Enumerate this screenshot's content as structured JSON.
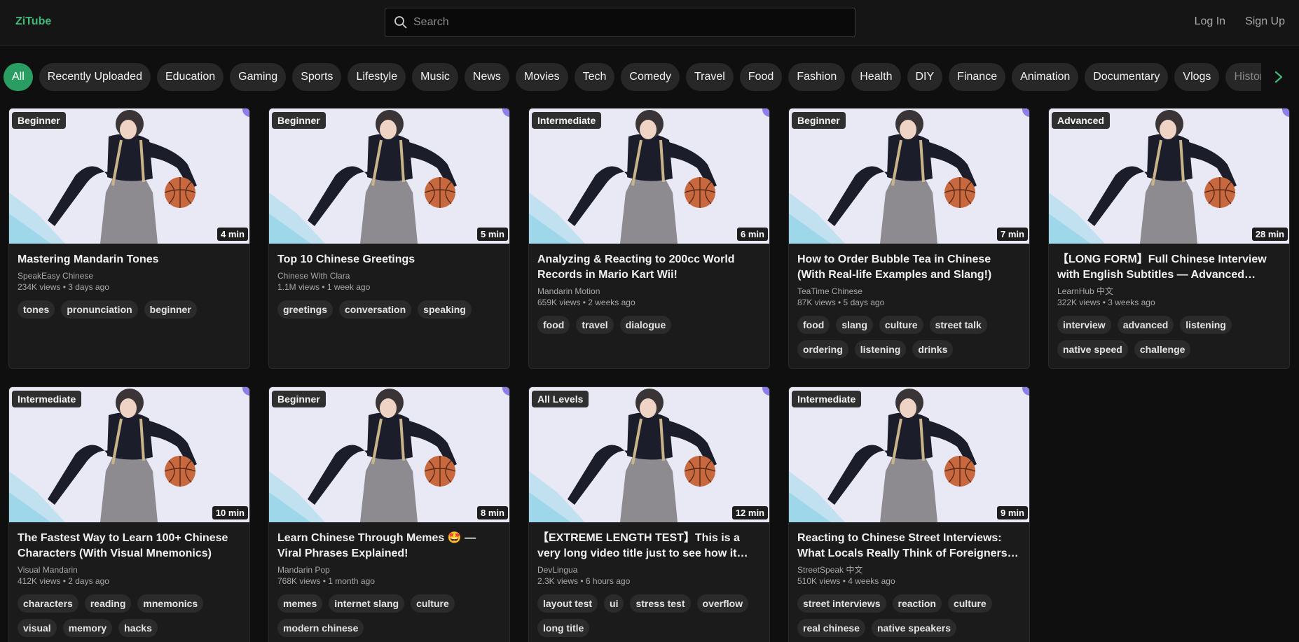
{
  "header": {
    "logo": "ZiTube",
    "search_placeholder": "Search",
    "login": "Log In",
    "signup": "Sign Up"
  },
  "chips": [
    "All",
    "Recently Uploaded",
    "Education",
    "Gaming",
    "Sports",
    "Lifestyle",
    "Music",
    "News",
    "Movies",
    "Tech",
    "Comedy",
    "Travel",
    "Food",
    "Fashion",
    "Health",
    "DIY",
    "Finance",
    "Animation",
    "Documentary",
    "Vlogs",
    "History"
  ],
  "active_chip": "All",
  "colors": {
    "accent": "#2a9d63",
    "logo": "#3fba7a",
    "background": "#0f0f0f"
  },
  "videos": [
    {
      "level": "Beginner",
      "duration": "4 min",
      "title": "Mastering Mandarin Tones",
      "channel": "SpeakEasy Chinese",
      "meta": "234K views • 3 days ago",
      "tags": [
        "tones",
        "pronunciation",
        "beginner"
      ]
    },
    {
      "level": "Beginner",
      "duration": "5 min",
      "title": "Top 10 Chinese Greetings",
      "channel": "Chinese With Clara",
      "meta": "1.1M views • 1 week ago",
      "tags": [
        "greetings",
        "conversation",
        "speaking"
      ]
    },
    {
      "level": "Intermediate",
      "duration": "6 min",
      "title": "Analyzing & Reacting to 200cc World Records in Mario Kart Wii!",
      "channel": "Mandarin Motion",
      "meta": "659K views • 2 weeks ago",
      "tags": [
        "food",
        "travel",
        "dialogue"
      ]
    },
    {
      "level": "Beginner",
      "duration": "7 min",
      "title": "How to Order Bubble Tea in Chinese (With Real-life Examples and Slang!)",
      "channel": "TeaTime Chinese",
      "meta": "87K views • 5 days ago",
      "tags": [
        "food",
        "slang",
        "culture",
        "street talk",
        "ordering",
        "listening",
        "drinks"
      ]
    },
    {
      "level": "Advanced",
      "duration": "28 min",
      "title": "【LONG FORM】Full Chinese Interview with English Subtitles — Advanced Listening Practice",
      "channel": "LearnHub 中文",
      "meta": "322K views • 3 weeks ago",
      "tags": [
        "interview",
        "advanced",
        "listening",
        "native speed",
        "challenge"
      ]
    },
    {
      "level": "Intermediate",
      "duration": "10 min",
      "title": "The Fastest Way to Learn 100+ Chinese Characters (With Visual Mnemonics)",
      "channel": "Visual Mandarin",
      "meta": "412K views • 2 days ago",
      "tags": [
        "characters",
        "reading",
        "mnemonics",
        "visual",
        "memory",
        "hacks"
      ]
    },
    {
      "level": "Beginner",
      "duration": "8 min",
      "title": "Learn Chinese Through Memes 🤩 — Viral Phrases Explained!",
      "channel": "Mandarin Pop",
      "meta": "768K views • 1 month ago",
      "tags": [
        "memes",
        "internet slang",
        "culture",
        "modern chinese"
      ]
    },
    {
      "level": "All Levels",
      "duration": "12 min",
      "title": "【EXTREME LENGTH TEST】This is a very long video title just to see how it wraps and overflows in the card layout",
      "channel": "DevLingua",
      "meta": "2.3K views • 6 hours ago",
      "tags": [
        "layout test",
        "ui",
        "stress test",
        "overflow",
        "long title"
      ]
    },
    {
      "level": "Intermediate",
      "duration": "9 min",
      "title": "Reacting to Chinese Street Interviews: What Locals Really Think of Foreigners Learning Chinese",
      "channel": "StreetSpeak 中文",
      "meta": "510K views • 4 weeks ago",
      "tags": [
        "street interviews",
        "reaction",
        "culture",
        "real chinese",
        "native speakers"
      ]
    }
  ]
}
